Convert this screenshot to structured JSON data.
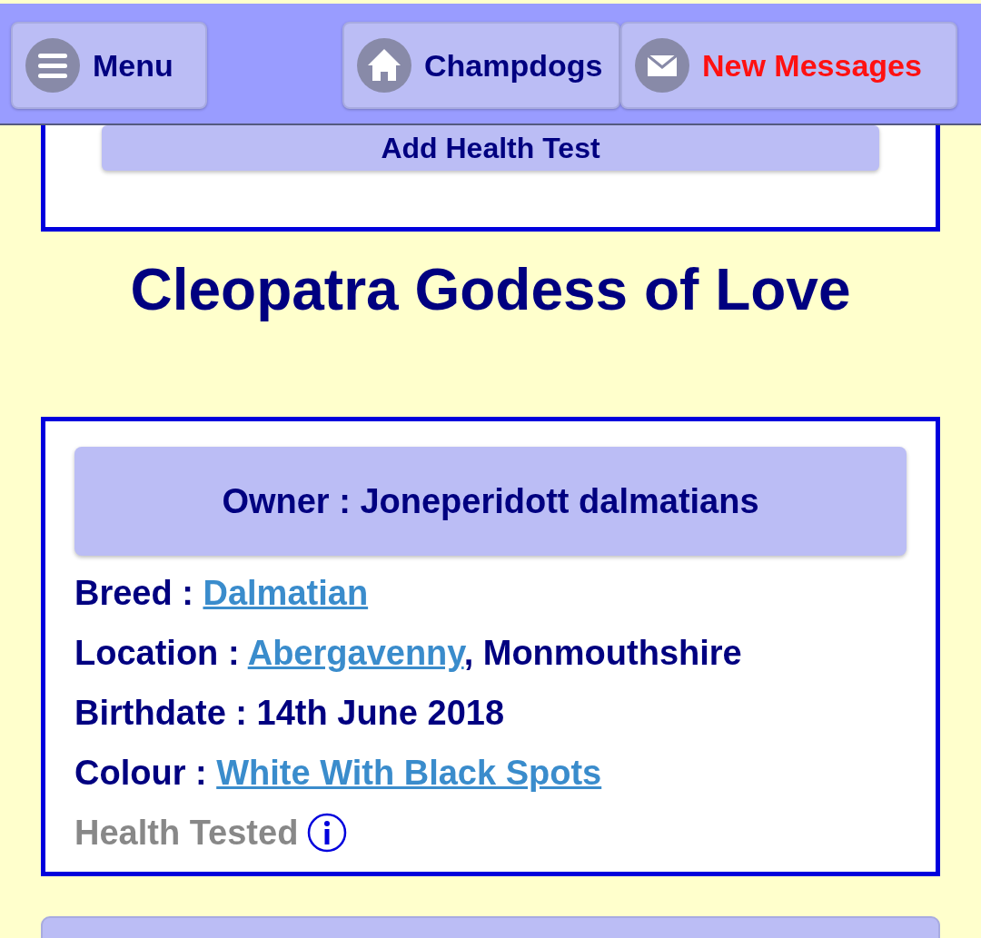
{
  "header": {
    "buttons": [
      {
        "kind": "menu",
        "label": "Menu",
        "alert": false
      },
      {
        "kind": "home",
        "label": "Champdogs",
        "alert": false
      },
      {
        "kind": "mail",
        "label": "New Messages",
        "alert": true
      }
    ]
  },
  "health_card": {
    "button": "Add Health Test"
  },
  "title": "Cleopatra Godess of Love",
  "profile": {
    "owner": "Owner : Joneperidott dalmatians",
    "details": [
      {
        "label": "Breed :",
        "parts": [
          {
            "text": "Dalmatian",
            "link": true
          }
        ]
      },
      {
        "label": "Location :",
        "parts": [
          {
            "text": "Abergavenny",
            "link": true
          },
          {
            "text": ", Monmouthshire",
            "link": false
          }
        ]
      },
      {
        "label": "Birthdate :",
        "parts": [
          {
            "text": "14th June 2018",
            "link": false
          }
        ]
      },
      {
        "label": "Colour :",
        "parts": [
          {
            "text": "White With Black Spots",
            "link": true
          }
        ]
      }
    ],
    "health_tested": {
      "label": "Health Tested",
      "disabled": true
    }
  }
}
